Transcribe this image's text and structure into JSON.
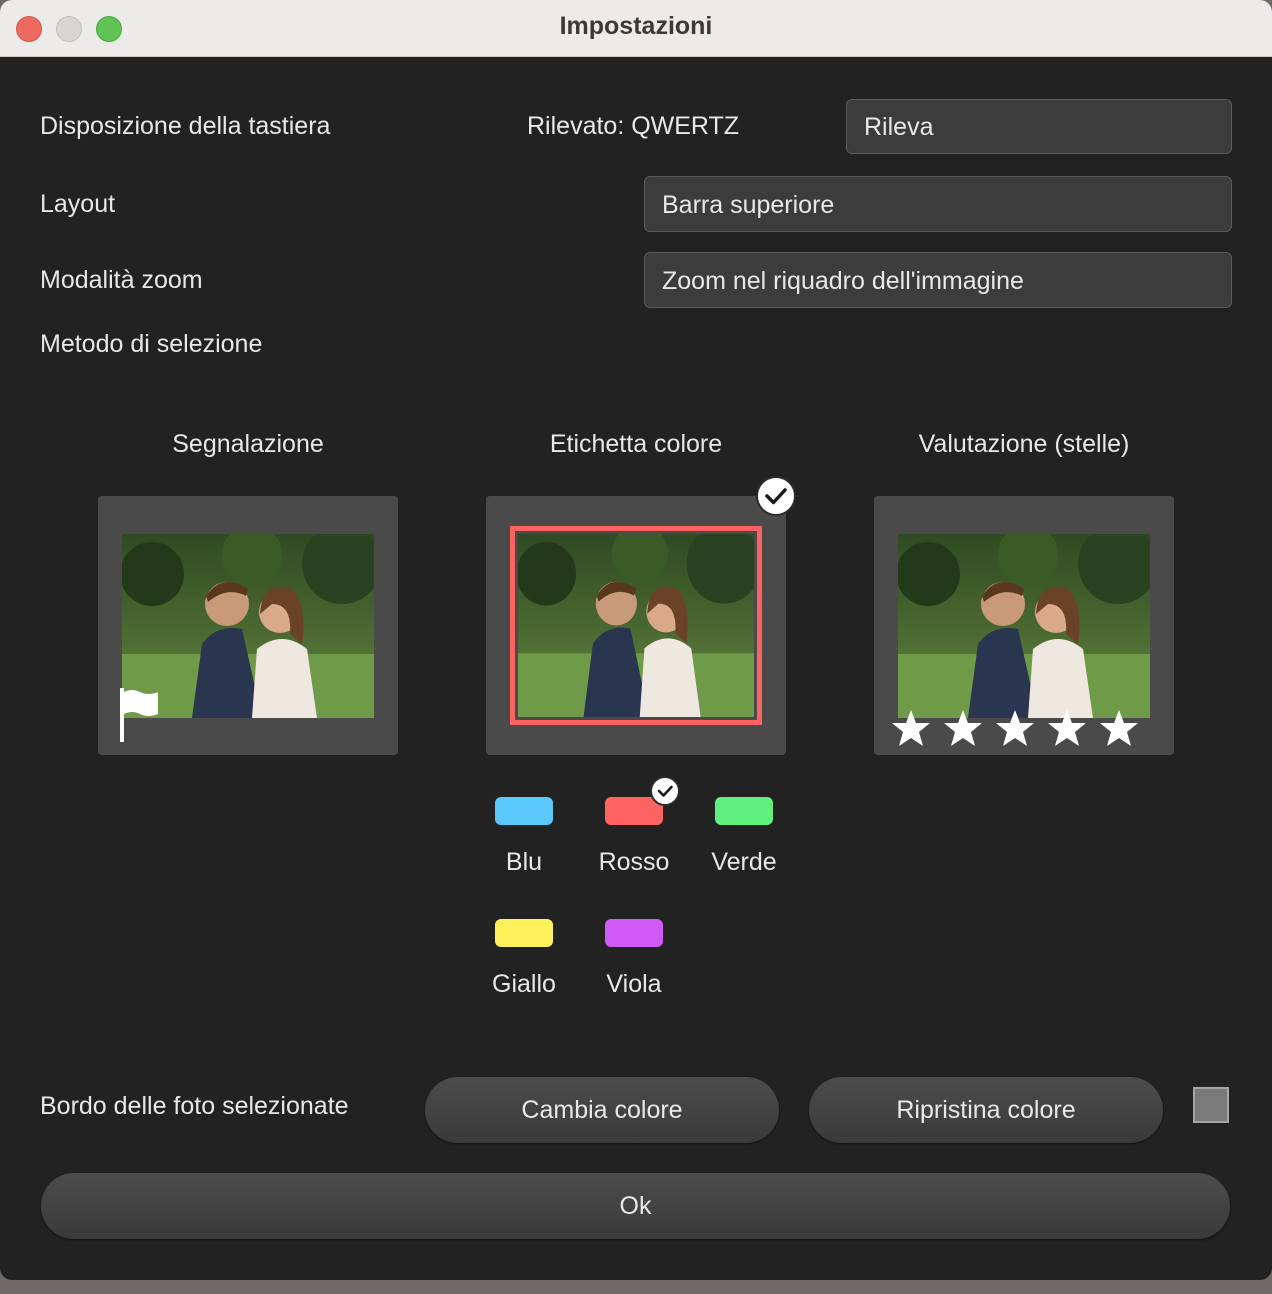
{
  "window": {
    "title": "Impostazioni"
  },
  "keyboard": {
    "label": "Disposizione della tastiera",
    "detected": "Rilevato: QWERTZ",
    "detect_button": "Rileva"
  },
  "layout": {
    "label": "Layout",
    "value": "Barra superiore"
  },
  "zoom": {
    "label": "Modalità zoom",
    "value": "Zoom nel riquadro dell'immagine"
  },
  "selection": {
    "label": "Metodo di selezione",
    "options": [
      {
        "title": "Segnalazione",
        "selected": false
      },
      {
        "title": "Etichetta colore",
        "selected": true
      },
      {
        "title": "Valutazione (stelle)",
        "selected": false
      }
    ],
    "stars": 5
  },
  "colors": {
    "selected": "Rosso",
    "items": [
      {
        "name": "Blu",
        "color": "#5ac8fa"
      },
      {
        "name": "Rosso",
        "color": "#ff6361"
      },
      {
        "name": "Verde",
        "color": "#5ff07d"
      },
      {
        "name": "Giallo",
        "color": "#fef05a"
      },
      {
        "name": "Viola",
        "color": "#cf5af5"
      }
    ]
  },
  "border": {
    "label": "Bordo delle foto selezionate",
    "change_button": "Cambia colore",
    "reset_button": "Ripristina colore",
    "preview_color": "#7a7a7a"
  },
  "ok_button": "Ok"
}
